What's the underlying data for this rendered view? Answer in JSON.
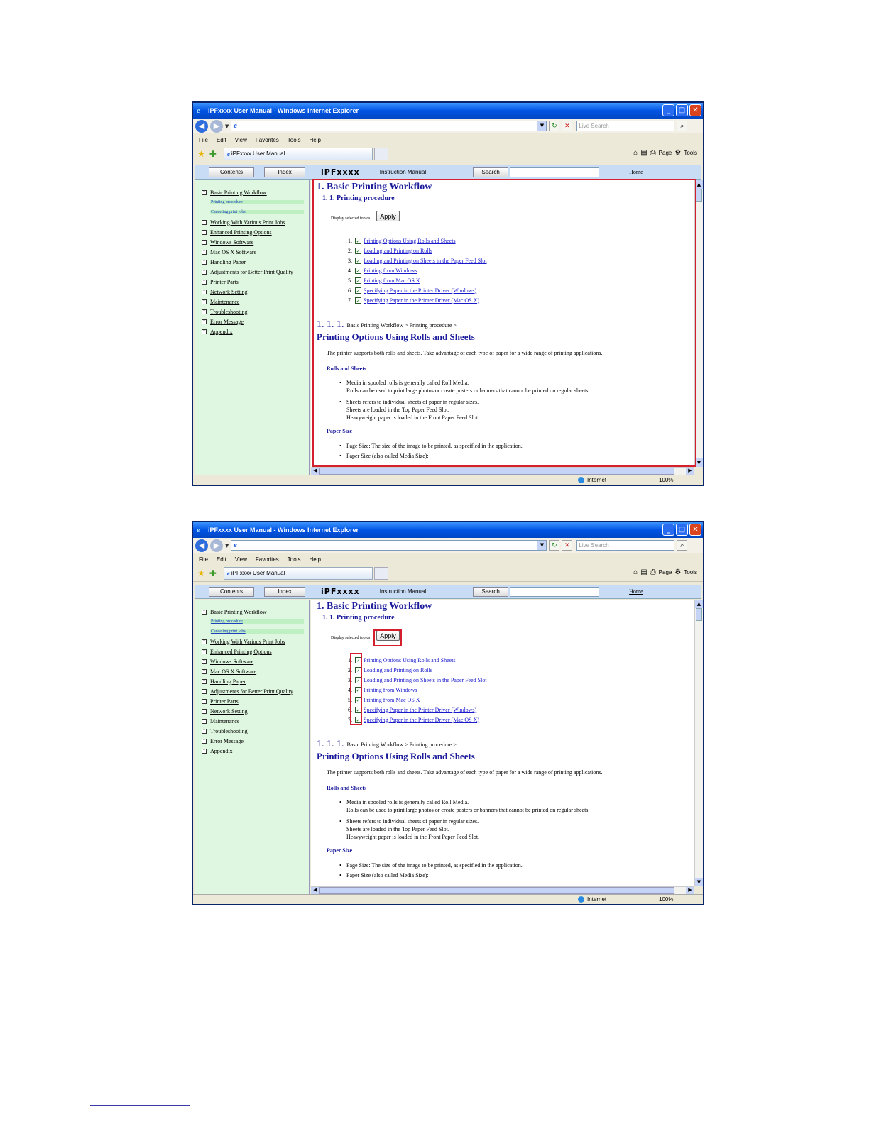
{
  "browser": {
    "title": "iPFxxxx User Manual - Windows Internet Explorer",
    "search_placeholder": "Live Search",
    "menu": [
      "File",
      "Edit",
      "View",
      "Favorites",
      "Tools",
      "Help"
    ],
    "tab_label": "iPFxxxx User Manual",
    "cmd_page": "Page",
    "cmd_tools": "Tools",
    "status_zone": "Internet",
    "zoom": "100%"
  },
  "app": {
    "contents_tab": "Contents",
    "index_tab": "Index",
    "brand": "iPFxxxx",
    "manual_label": "Instruction Manual",
    "search_button": "Search",
    "home_link": "Home"
  },
  "sidebar": {
    "items": [
      {
        "label": "Basic Printing Workflow",
        "sub": false
      },
      {
        "label": "Printing procedure",
        "sub": true
      },
      {
        "label": "Canceling print jobs",
        "sub": true
      },
      {
        "label": "Working With Various Print Jobs",
        "sub": false
      },
      {
        "label": "Enhanced Printing Options",
        "sub": false
      },
      {
        "label": "Windows Software",
        "sub": false
      },
      {
        "label": "Mac OS X Software",
        "sub": false
      },
      {
        "label": "Handling Paper",
        "sub": false
      },
      {
        "label": "Adjustments for Better Print Quality",
        "sub": false
      },
      {
        "label": "Printer Parts",
        "sub": false
      },
      {
        "label": "Network Setting",
        "sub": false
      },
      {
        "label": "Maintenance",
        "sub": false
      },
      {
        "label": "Troubleshooting",
        "sub": false
      },
      {
        "label": "Error Message",
        "sub": false
      },
      {
        "label": "Appendix",
        "sub": false
      }
    ]
  },
  "content": {
    "h1": "1. Basic Printing Workflow",
    "h2": "1. 1. Printing procedure",
    "display_selected": "Display selected topics",
    "apply": "Apply",
    "topics": [
      {
        "num": "1.",
        "label": "Printing Options Using Rolls and Sheets"
      },
      {
        "num": "2.",
        "label": "Loading and Printing on Rolls"
      },
      {
        "num": "3.",
        "label": "Loading and Printing on Sheets in the Paper Feed Slot"
      },
      {
        "num": "4.",
        "label": "Printing from Windows"
      },
      {
        "num": "5.",
        "label": "Printing from Mac OS X"
      },
      {
        "num": "6.",
        "label": "Specifying Paper in the Printer Driver (Windows)"
      },
      {
        "num": "7.",
        "label": "Specifying Paper in the Printer Driver (Mac OS X)"
      }
    ],
    "section_num": "1. 1. 1.",
    "breadcrumb": "Basic Printing Workflow > Printing procedure >",
    "section_title": "Printing Options Using Rolls and Sheets",
    "intro": "The printer supports both rolls and sheets. Take advantage of each type of paper for a wide range of printing applications.",
    "rolls_heading": "Rolls and Sheets",
    "rolls_b1_l1": "Media in spooled rolls is generally called Roll Media.",
    "rolls_b1_l2": "Rolls can be used to print large photos or create posters or banners that cannot be printed on regular sheets.",
    "rolls_b2_l1": "Sheets refers to individual sheets of paper in regular sizes.",
    "rolls_b2_l2": "Sheets are loaded in the Top Paper Feed Slot.",
    "rolls_b2_l3": "Heavyweight paper is loaded in the Front Paper Feed Slot.",
    "paper_heading": "Paper Size",
    "paper_b1": "Page Size: The size of the image to be printed, as specified in the application.",
    "paper_b2": "Paper Size (also called Media Size):"
  }
}
